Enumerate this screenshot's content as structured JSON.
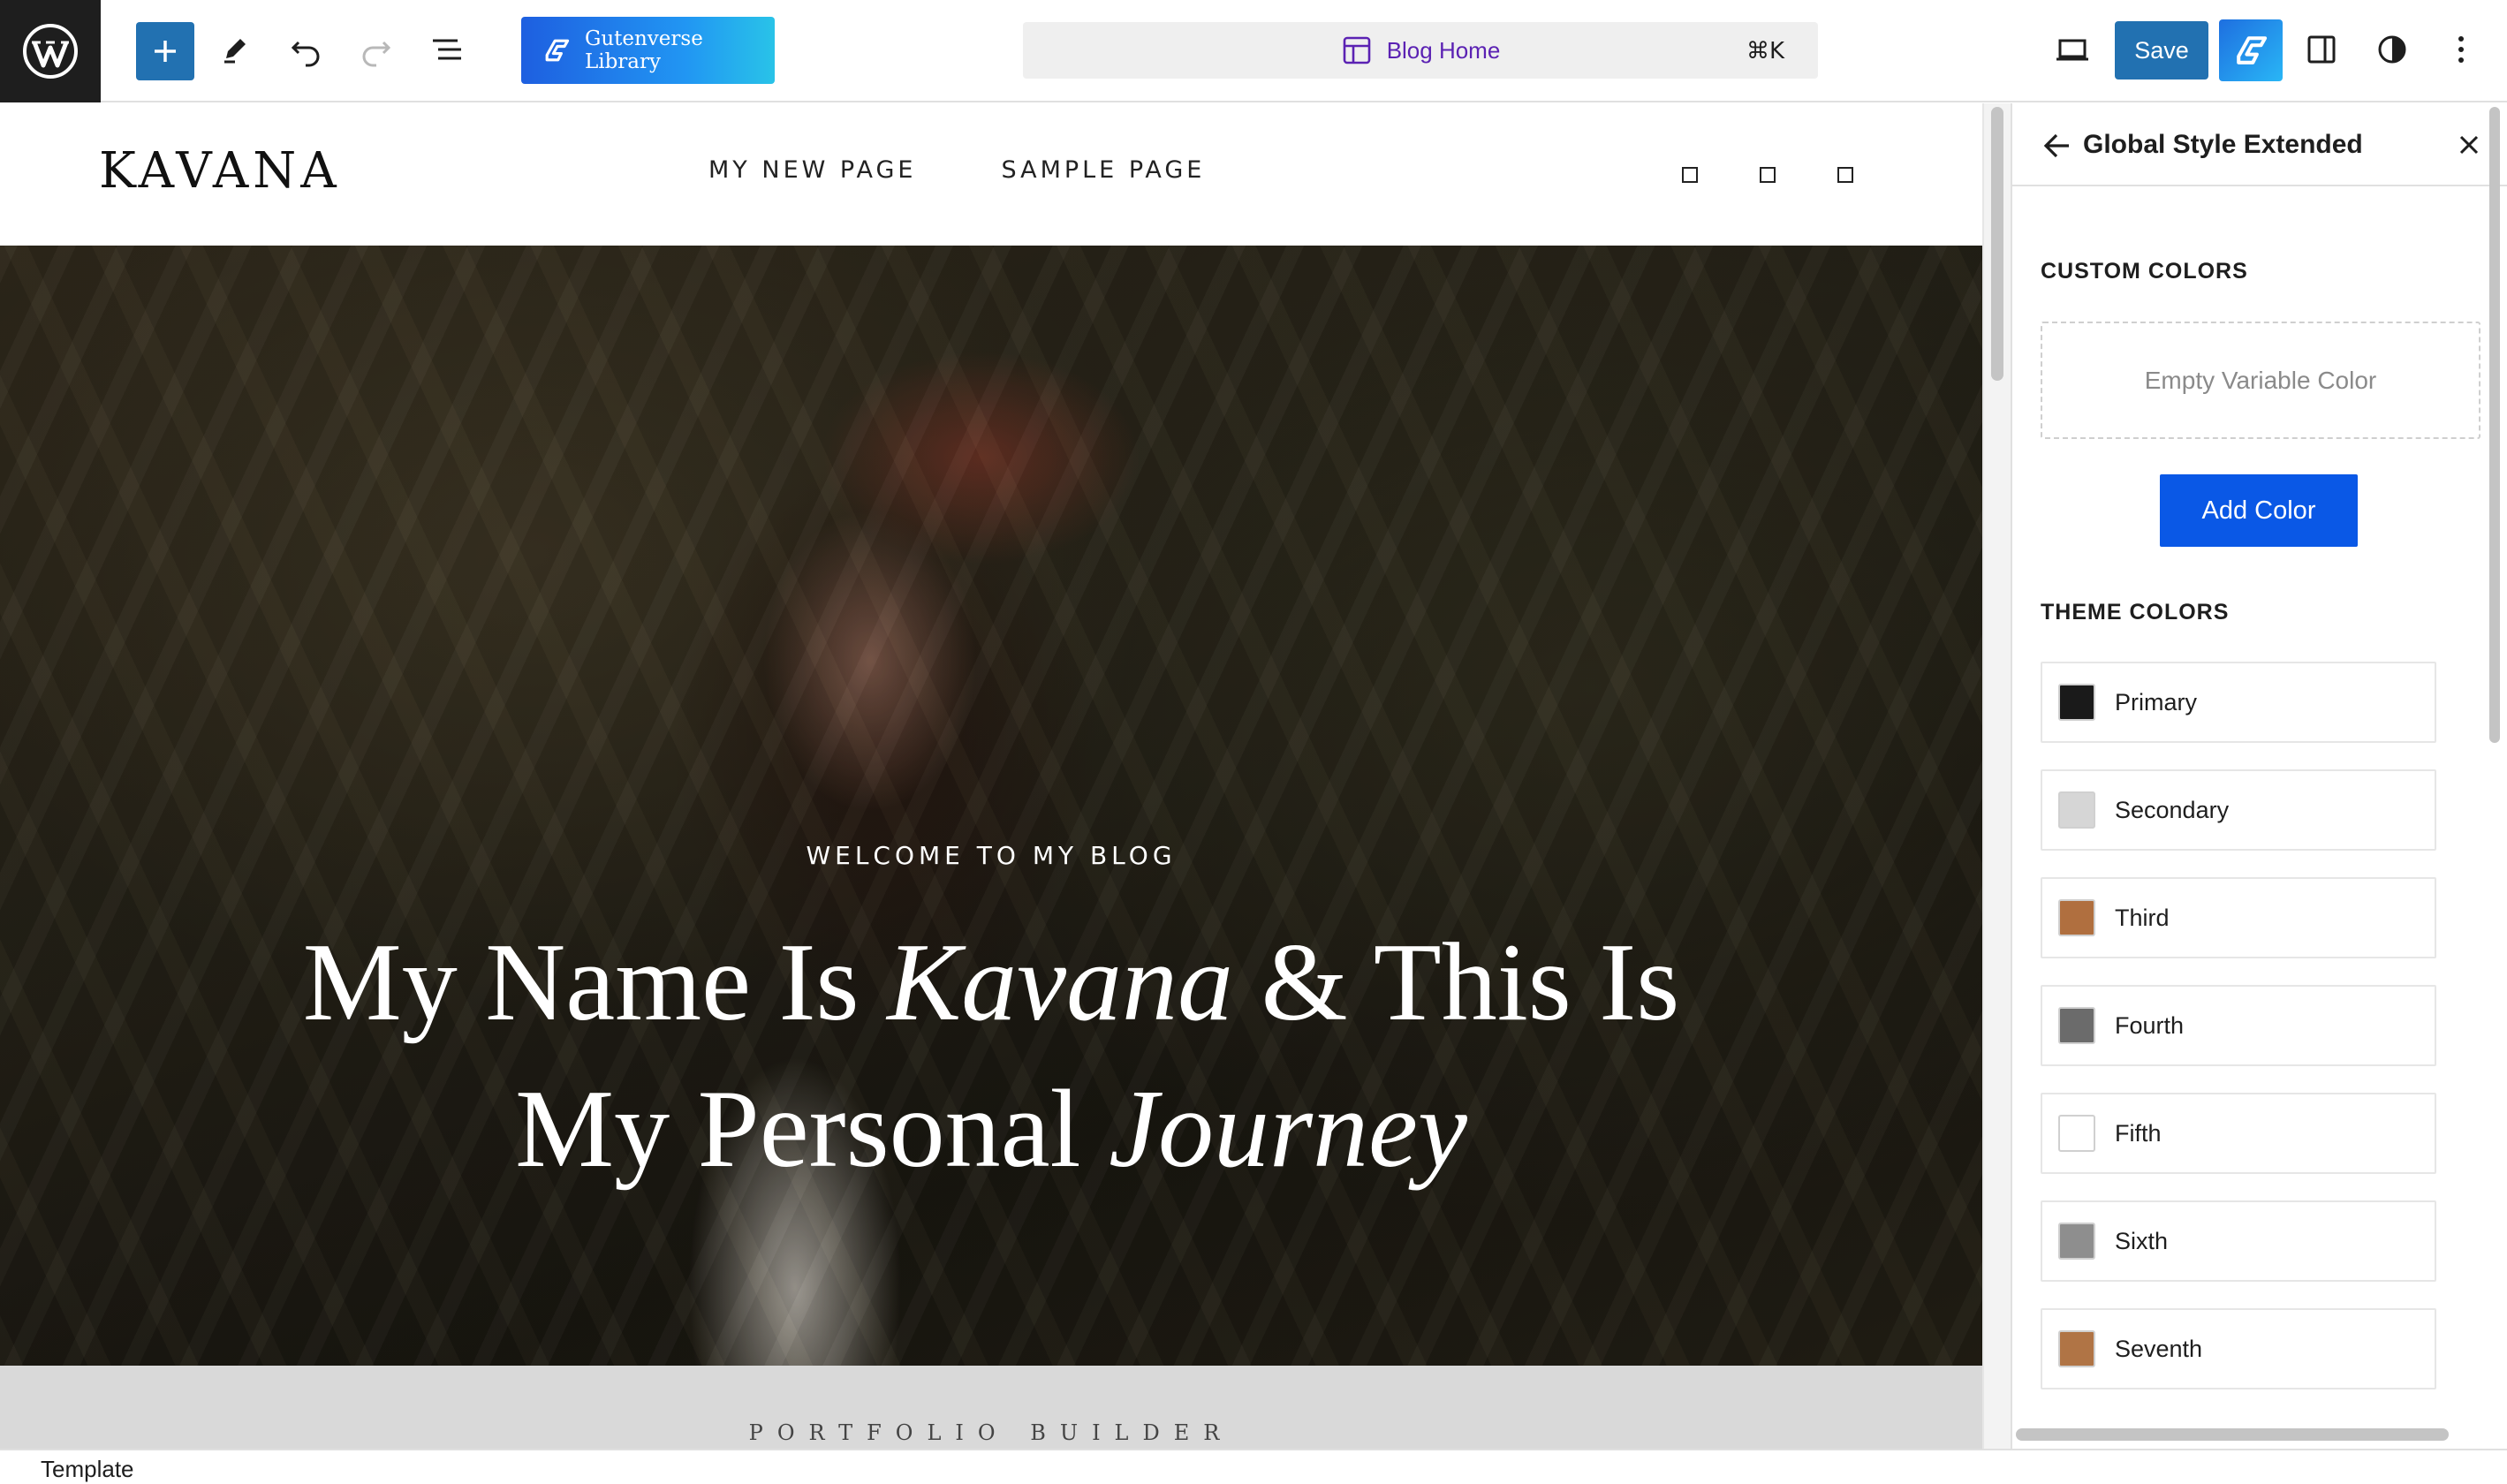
{
  "toolbar": {
    "gutenverse_library_label": "Gutenverse Library",
    "command_title": "Blog Home",
    "command_shortcut": "⌘K",
    "save_label": "Save",
    "icons": [
      "wordpress-logo-icon",
      "plus-icon",
      "pencil-icon",
      "undo-icon",
      "redo-icon",
      "list-view-icon",
      "gutenverse-icon",
      "layout-template-icon",
      "desktop-preview-icon",
      "gutenverse-icon",
      "sidebar-toggle-icon",
      "style-contrast-icon",
      "more-vertical-icon"
    ]
  },
  "site": {
    "logo": "KAVANA",
    "nav": [
      "MY NEW PAGE",
      "SAMPLE PAGE"
    ]
  },
  "hero": {
    "eyebrow": "WELCOME TO MY BLOG",
    "title_line1_a": "My Name Is ",
    "title_line1_b": "Kavana",
    "title_line1_c": " & This Is",
    "title_line2_a": "My Personal ",
    "title_line2_b": "Journey"
  },
  "band": {
    "text": "PORTFOLIO BUILDER"
  },
  "sidebar": {
    "title": "Global Style Extended",
    "custom_colors_title": "CUSTOM COLORS",
    "empty_label": "Empty Variable Color",
    "add_color_label": "Add Color",
    "theme_colors_title": "THEME COLORS",
    "theme_colors": [
      {
        "name": "Primary",
        "color": "#1a1a1a"
      },
      {
        "name": "Secondary",
        "color": "#d6d6d6"
      },
      {
        "name": "Third",
        "color": "#b06f3f"
      },
      {
        "name": "Fourth",
        "color": "#6b6b6b"
      },
      {
        "name": "Fifth",
        "color": "#ffffff"
      },
      {
        "name": "Sixth",
        "color": "#8e8e8e"
      },
      {
        "name": "Seventh",
        "color": "#b07445"
      }
    ]
  },
  "footer": {
    "label": "Template"
  },
  "colors": {
    "wp_admin_blue": "#2271b1",
    "add_color_blue": "#0a58e6",
    "command_purple": "#5b22b3"
  }
}
